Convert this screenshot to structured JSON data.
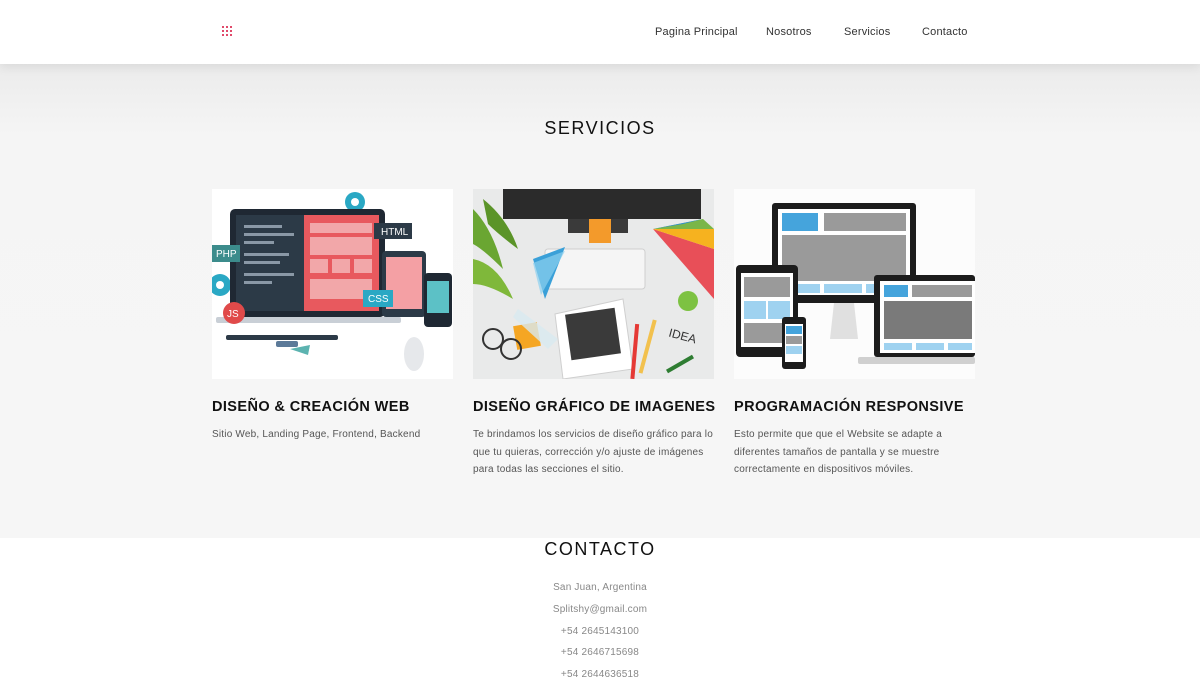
{
  "nav": {
    "logo_icon": "dot-grid-logo-icon",
    "accent_color": "#e04a6a",
    "links": [
      "Pagina Principal",
      "Nosotros",
      "Servicios",
      "Contacto"
    ]
  },
  "services": {
    "title": "SERVICIOS",
    "cards": [
      {
        "image_icon": "web-development-illustration",
        "title": "DISEÑO & CREACIÓN WEB",
        "text": "Sitio Web, Landing Page, Frontend, Backend",
        "image_labels": [
          "HTML",
          "PHP",
          "CSS",
          "JS"
        ]
      },
      {
        "image_icon": "graphic-design-desk-photo",
        "title": "DISEÑO GRÁFICO DE IMAGENES",
        "text": "Te brindamos los servicios de diseño gráfico para lo que tu quieras, corrección y/o ajuste de imágenes para todas las secciones el sitio."
      },
      {
        "image_icon": "responsive-devices-illustration",
        "title": "PROGRAMACIÓN RESPONSIVE",
        "text": "Esto permite que que el Website se adapte a diferentes tamaños de pantalla y se muestre correctamente en dispositivos móviles."
      }
    ]
  },
  "contact": {
    "title": "CONTACTO",
    "lines": [
      "San Juan, Argentina",
      "Splitshy@gmail.com",
      "+54 2645143100",
      "+54 2646715698",
      "+54 2644636518"
    ]
  }
}
